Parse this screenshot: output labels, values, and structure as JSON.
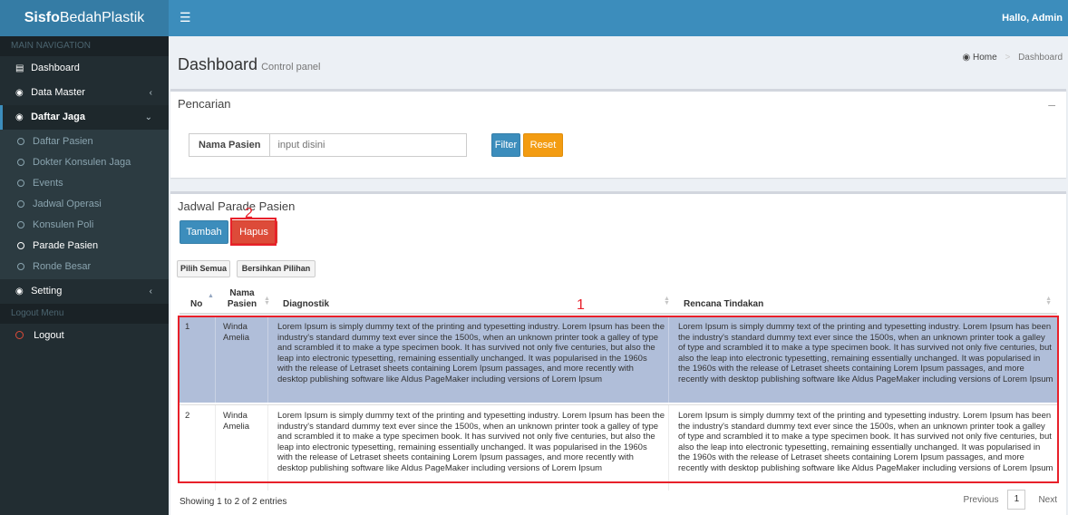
{
  "app": {
    "brand_bold": "Sisfo",
    "brand_rest": "BedahPlastik",
    "greeting": "Hallo, Admin"
  },
  "sidebar": {
    "main_header": "MAIN NAVIGATION",
    "dashboard": "Dashboard",
    "data_master": "Data Master",
    "daftar_jaga": "Daftar Jaga",
    "sub_items": [
      "Daftar Pasien",
      "Dokter Konsulen Jaga",
      "Events",
      "Jadwal Operasi",
      "Konsulen Poli",
      "Parade Pasien",
      "Ronde Besar"
    ],
    "setting": "Setting",
    "logout_header": "Logout Menu",
    "logout": "Logout"
  },
  "page": {
    "title": "Dashboard",
    "subtitle": "Control panel"
  },
  "breadcrumb": {
    "home": "Home",
    "current": "Dashboard"
  },
  "search": {
    "box_title": "Pencarian",
    "label": "Nama Pasien",
    "placeholder": "input disini",
    "filter_label": "Filter",
    "reset_label": "Reset"
  },
  "table_box": {
    "title": "Jadwal Parade Pasien",
    "tambah_label": "Tambah",
    "hapus_label": "Hapus",
    "pilih_semua_label": "Pilih Semua",
    "bersihkan_label": "Bersihkan Pilihan",
    "columns": {
      "no": "No",
      "nama_line1": "Nama",
      "nama_line2": "Pasien",
      "diagnostik": "Diagnostik",
      "rencana": "Rencana Tindakan"
    },
    "rows": [
      {
        "no": "1",
        "nama": "Winda Amelia",
        "diagnostik": "Lorem Ipsum is simply dummy text of the printing and typesetting industry. Lorem Ipsum has been the industry's standard dummy text ever since the 1500s, when an unknown printer took a galley of type and scrambled it to make a type specimen book. It has survived not only five centuries, but also the leap into electronic typesetting, remaining essentially unchanged. It was popularised in the 1960s with the release of Letraset sheets containing Lorem Ipsum passages, and more recently with desktop publishing software like Aldus PageMaker including versions of Lorem Ipsum",
        "rencana": "Lorem Ipsum is simply dummy text of the printing and typesetting industry. Lorem Ipsum has been the industry's standard dummy text ever since the 1500s, when an unknown printer took a galley of type and scrambled it to make a type specimen book. It has survived not only five centuries, but also the leap into electronic typesetting, remaining essentially unchanged. It was popularised in the 1960s with the release of Letraset sheets containing Lorem Ipsum passages, and more recently with desktop publishing software like Aldus PageMaker including versions of Lorem Ipsum"
      },
      {
        "no": "2",
        "nama": "Winda Amelia",
        "diagnostik": "Lorem Ipsum is simply dummy text of the printing and typesetting industry. Lorem Ipsum has been the industry's standard dummy text ever since the 1500s, when an unknown printer took a galley of type and scrambled it to make a type specimen book. It has survived not only five centuries, but also the leap into electronic typesetting, remaining essentially unchanged. It was popularised in the 1960s with the release of Letraset sheets containing Lorem Ipsum passages, and more recently with desktop publishing software like Aldus PageMaker including versions of Lorem Ipsum",
        "rencana": "Lorem Ipsum is simply dummy text of the printing and typesetting industry. Lorem Ipsum has been the industry's standard dummy text ever since the 1500s, when an unknown printer took a galley of type and scrambled it to make a type specimen book. It has survived not only five centuries, but also the leap into electronic typesetting, remaining essentially unchanged. It was popularised in the 1960s with the release of Letraset sheets containing Lorem Ipsum passages, and more recently with desktop publishing software like Aldus PageMaker including versions of Lorem Ipsum"
      }
    ],
    "showing": "Showing 1 to 2 of 2 entries",
    "pager": {
      "previous": "Previous",
      "current": "1",
      "next": "Next"
    }
  },
  "annotations": {
    "marker_1": "1",
    "marker_2": "2"
  },
  "colors": {
    "header": "#3c8dbc",
    "sidebar": "#222d32",
    "primary": "#3c8dbc",
    "danger": "#dd4b39",
    "warning": "#f39c12",
    "selected_row": "#b0bed9",
    "annotation": "#e8202a"
  },
  "icons": {
    "menu": "hamburger-icon",
    "dashboard": "book-icon",
    "data_master": "dashboard-icon",
    "home": "home-icon",
    "collapse": "minus-icon"
  }
}
